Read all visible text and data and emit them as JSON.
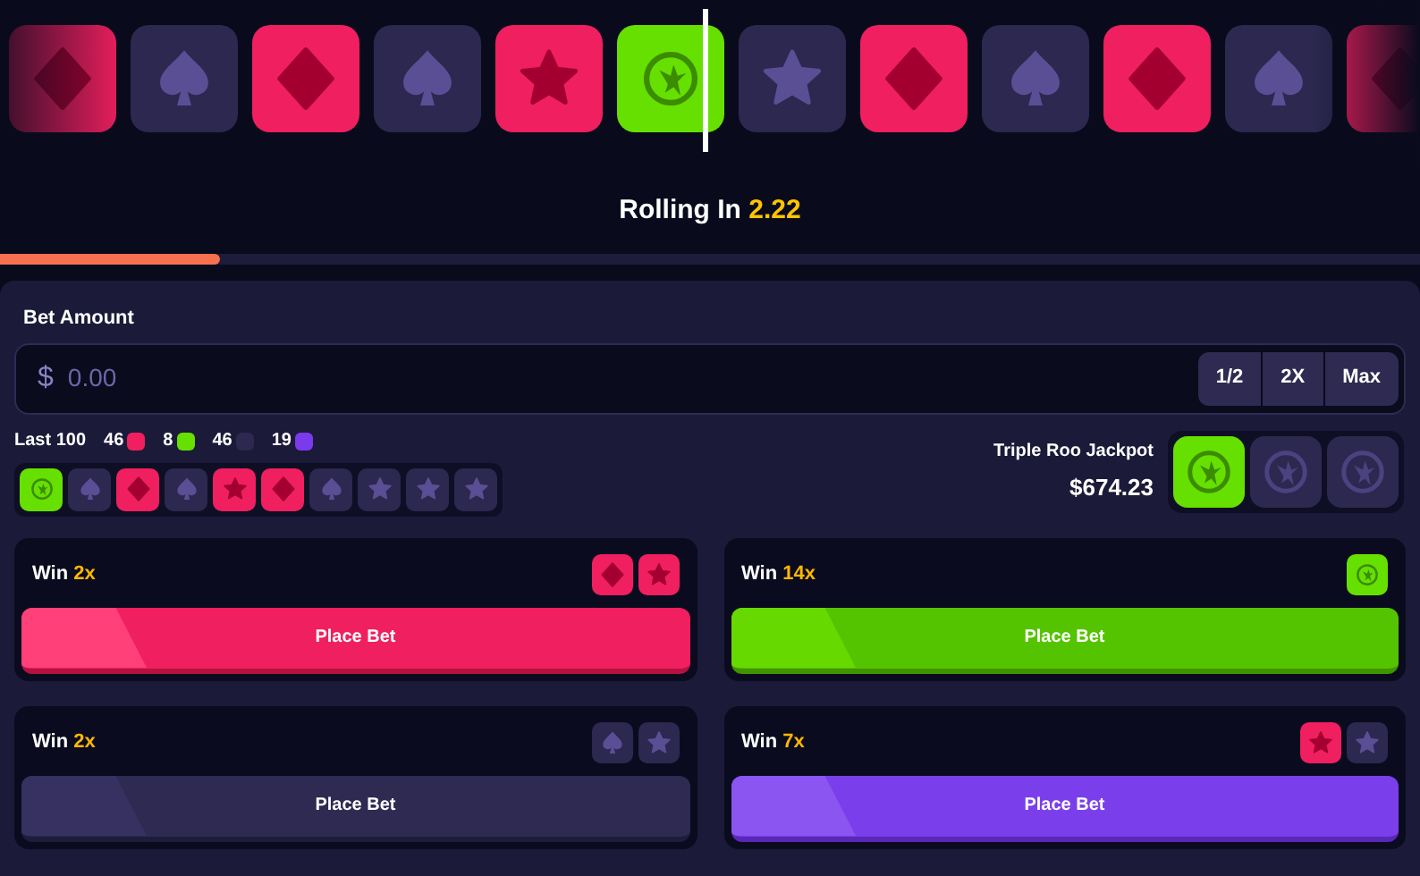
{
  "reel": {
    "tiles": [
      {
        "kind": "diamond"
      },
      {
        "kind": "spade"
      },
      {
        "kind": "diamond"
      },
      {
        "kind": "spade"
      },
      {
        "kind": "red_star"
      },
      {
        "kind": "roo"
      },
      {
        "kind": "dark_star"
      },
      {
        "kind": "diamond"
      },
      {
        "kind": "spade"
      },
      {
        "kind": "diamond"
      },
      {
        "kind": "spade"
      },
      {
        "kind": "diamond"
      }
    ]
  },
  "countdown": {
    "label": "Rolling In",
    "value": "2.22",
    "level": 0.155
  },
  "bet": {
    "label": "Bet Amount",
    "currency": "$",
    "placeholder": "0.00",
    "buttons": [
      "1/2",
      "2X",
      "Max"
    ]
  },
  "history": {
    "label": "Last 100",
    "counts": [
      {
        "value": "46",
        "color": "#f01f5f"
      },
      {
        "value": "8",
        "color": "#66e000"
      },
      {
        "value": "46",
        "color": "#2c2850"
      },
      {
        "value": "19",
        "color": "#7c3aed"
      }
    ],
    "tiles": [
      {
        "kind": "roo"
      },
      {
        "kind": "spade"
      },
      {
        "kind": "diamond"
      },
      {
        "kind": "spade"
      },
      {
        "kind": "red_star"
      },
      {
        "kind": "diamond"
      },
      {
        "kind": "spade"
      },
      {
        "kind": "dark_star"
      },
      {
        "kind": "dark_star"
      },
      {
        "kind": "dark_star"
      }
    ]
  },
  "jackpot": {
    "label": "Triple Roo Jackpot",
    "amount": "$674.23",
    "slots": [
      {
        "lit": true
      },
      {
        "lit": false
      },
      {
        "lit": false
      }
    ]
  },
  "bets": [
    {
      "label": "Win",
      "multiplier": "2x",
      "kind": "red",
      "button": "Place Bet",
      "tiles": [
        {
          "kind": "diamond"
        },
        {
          "kind": "red_star"
        }
      ]
    },
    {
      "label": "Win",
      "multiplier": "14x",
      "kind": "green",
      "button": "Place Bet",
      "tiles": [
        {
          "kind": "roo"
        }
      ]
    },
    {
      "label": "Win",
      "multiplier": "2x",
      "kind": "dark",
      "button": "Place Bet",
      "tiles": [
        {
          "kind": "spade"
        },
        {
          "kind": "dark_star"
        }
      ]
    },
    {
      "label": "Win",
      "multiplier": "7x",
      "kind": "purple",
      "button": "Place Bet",
      "tiles": [
        {
          "kind": "red_star"
        },
        {
          "kind": "dark_star"
        }
      ]
    }
  ]
}
